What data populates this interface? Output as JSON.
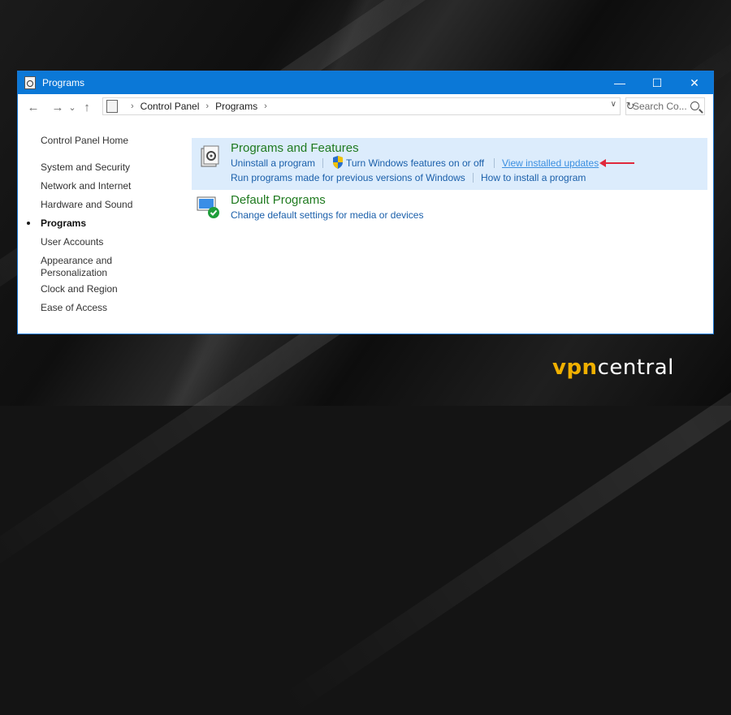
{
  "window": {
    "title": "Programs",
    "controls": {
      "minimize": "—",
      "maximize": "☐",
      "close": "✕"
    }
  },
  "address_bar": {
    "back": "←",
    "forward": "→",
    "recent": "⌄",
    "up": "↑",
    "breadcrumbs": [
      "Control Panel",
      "Programs"
    ],
    "dropdown": "∨",
    "refresh": "↻",
    "search_placeholder": "Search Co..."
  },
  "sidebar": {
    "items": [
      {
        "label": "Control Panel Home"
      },
      {
        "label": "System and Security"
      },
      {
        "label": "Network and Internet"
      },
      {
        "label": "Hardware and Sound"
      },
      {
        "label": "Programs",
        "active": true
      },
      {
        "label": "User Accounts"
      },
      {
        "label": "Appearance and"
      },
      {
        "label": "Personalization"
      },
      {
        "label": "Clock and Region"
      },
      {
        "label": "Ease of Access"
      }
    ]
  },
  "sections": [
    {
      "title": "Programs and Features",
      "links_row1": [
        "Uninstall a program",
        "Turn Windows features on or off",
        "View installed updates"
      ],
      "links_row2": [
        "Run programs made for previous versions of Windows",
        "How to install a program"
      ]
    },
    {
      "title": "Default Programs",
      "links_row1": [
        "Change default settings for media or devices"
      ]
    }
  ],
  "watermark": {
    "v": "vpn",
    "rest": "central"
  },
  "colors": {
    "titlebar": "#0b78d7",
    "link": "#1a5faa",
    "section_title": "#1f7a1f",
    "arrow": "#e0283b",
    "highlight": "#dcecfc"
  },
  "icons": [
    "programs-icon",
    "shield-icon",
    "default-programs-icon"
  ]
}
